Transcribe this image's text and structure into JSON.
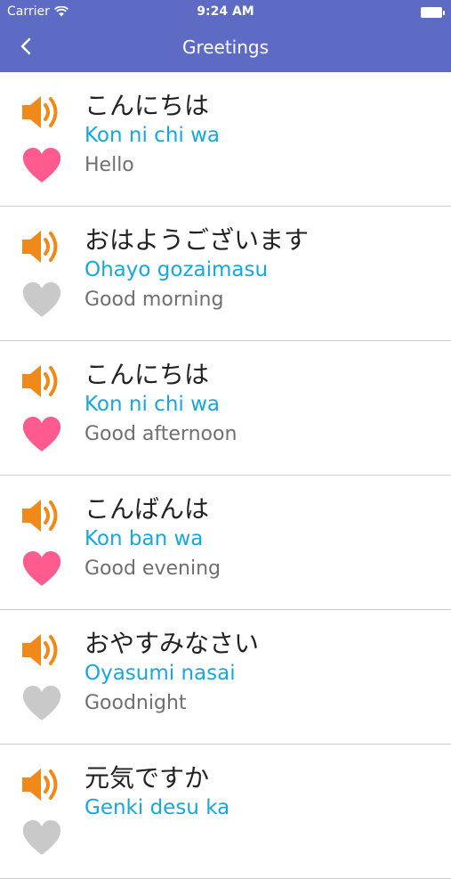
{
  "status_bar": {
    "carrier": "Carrier",
    "time": "9:24 AM"
  },
  "nav": {
    "title": "Greetings",
    "back_icon": "chevron-left-icon"
  },
  "colors": {
    "nav_background": "#5e6bc4",
    "romaji": "#16a7dd",
    "speaker": "#ef8a1a",
    "heart_favorite": "#ff5b8e",
    "heart_inactive": "#c9c9c9"
  },
  "phrases": [
    {
      "japanese": "こんにちは",
      "romaji": "Kon ni chi wa",
      "english": "Hello",
      "favorite": true
    },
    {
      "japanese": "おはようございます",
      "romaji": "Ohayo gozaimasu",
      "english": "Good morning",
      "favorite": false
    },
    {
      "japanese": "こんにちは",
      "romaji": "Kon ni chi wa",
      "english": "Good afternoon",
      "favorite": true
    },
    {
      "japanese": "こんばんは",
      "romaji": "Kon ban wa",
      "english": "Good evening",
      "favorite": true
    },
    {
      "japanese": "おやすみなさい",
      "romaji": "Oyasumi nasai",
      "english": "Goodnight",
      "favorite": false
    },
    {
      "japanese": "元気ですか",
      "romaji": "Genki desu ka",
      "english": "",
      "favorite": false
    }
  ]
}
